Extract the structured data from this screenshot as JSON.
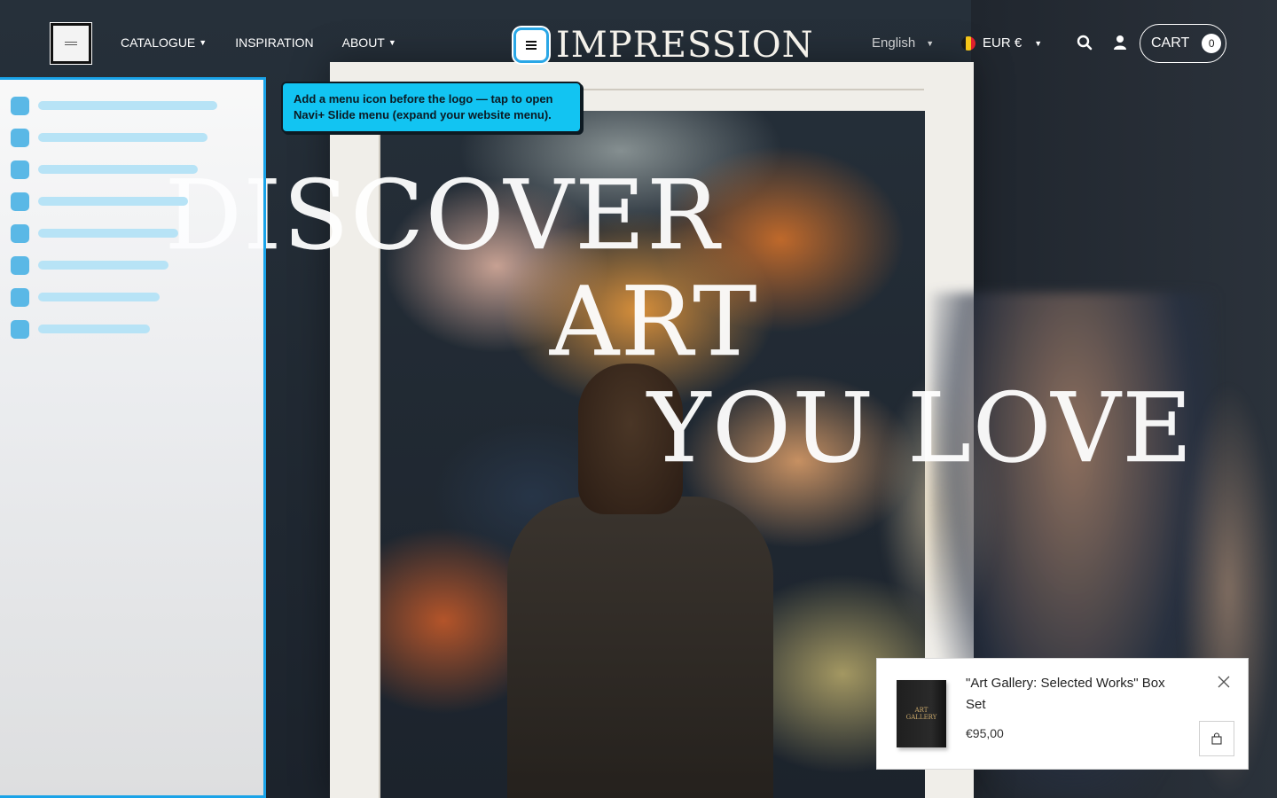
{
  "header": {
    "nav": [
      {
        "label": "CATALOGUE",
        "has_dropdown": true
      },
      {
        "label": "INSPIRATION",
        "has_dropdown": false
      },
      {
        "label": "ABOUT",
        "has_dropdown": true
      }
    ],
    "logo_text": "IMPRESSION",
    "language": "English",
    "currency": "EUR €",
    "cart_label": "CART",
    "cart_count": "0"
  },
  "hero": {
    "line1": "DISCOVER",
    "line2": "ART",
    "line3": "YOU LOVE"
  },
  "tooltip": {
    "text": "Add a menu icon before the logo — tap to open Navi+ Slide menu (expand your website menu)."
  },
  "popup": {
    "product_title": "\"Art Gallery: Selected Works\" Box Set",
    "price": "€95,00",
    "thumb_text": "ART GALLERY"
  },
  "icons": [
    "menu-icon",
    "caret-down-icon",
    "search-icon",
    "user-icon",
    "close-icon",
    "bag-icon",
    "belgium-flag-icon"
  ],
  "colors": {
    "accent": "#1aa3e8",
    "tooltip": "#12c4f2"
  }
}
